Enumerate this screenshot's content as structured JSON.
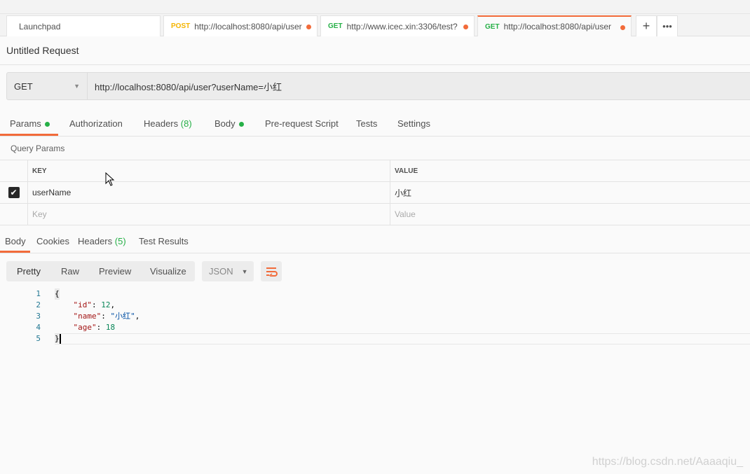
{
  "tabs": [
    {
      "label": "Launchpad",
      "method": "",
      "method_color": "",
      "dirty": false
    },
    {
      "label": "http://localhost:8080/api/user",
      "method": "POST",
      "method_color": "#f4b400",
      "dirty": true
    },
    {
      "label": "http://www.icec.xin:3306/test?",
      "method": "GET",
      "method_color": "#26b047",
      "dirty": true
    },
    {
      "label": "http://localhost:8080/api/user",
      "method": "GET",
      "method_color": "#26b047",
      "dirty": true,
      "active": true
    }
  ],
  "title": "Untitled Request",
  "request": {
    "method": "GET",
    "url": "http://localhost:8080/api/user?userName=小红"
  },
  "request_tabs": {
    "params": "Params",
    "authorization": "Authorization",
    "headers": "Headers",
    "headers_count": "(8)",
    "body": "Body",
    "prerequest": "Pre-request Script",
    "tests": "Tests",
    "settings": "Settings"
  },
  "query_params": {
    "label": "Query Params",
    "key_header": "KEY",
    "value_header": "VALUE",
    "rows": [
      {
        "checked": true,
        "key": "userName",
        "value": "小红"
      }
    ],
    "key_placeholder": "Key",
    "value_placeholder": "Value"
  },
  "response_tabs": {
    "body": "Body",
    "cookies": "Cookies",
    "headers": "Headers",
    "headers_count": "(5)",
    "test_results": "Test Results"
  },
  "view_modes": {
    "pretty": "Pretty",
    "raw": "Raw",
    "preview": "Preview",
    "visualize": "Visualize",
    "format": "JSON"
  },
  "code": {
    "l1": "1",
    "l2": "2",
    "l3": "3",
    "l4": "4",
    "l5": "5",
    "open": "{",
    "close": "}",
    "k_id": "\"id\"",
    "v_id": "12",
    "k_name": "\"name\"",
    "v_name": "\"小红\"",
    "k_age": "\"age\"",
    "v_age": "18"
  },
  "watermark": "https://blog.csdn.net/Aaaaqiu_",
  "accent": "#f26b3a"
}
